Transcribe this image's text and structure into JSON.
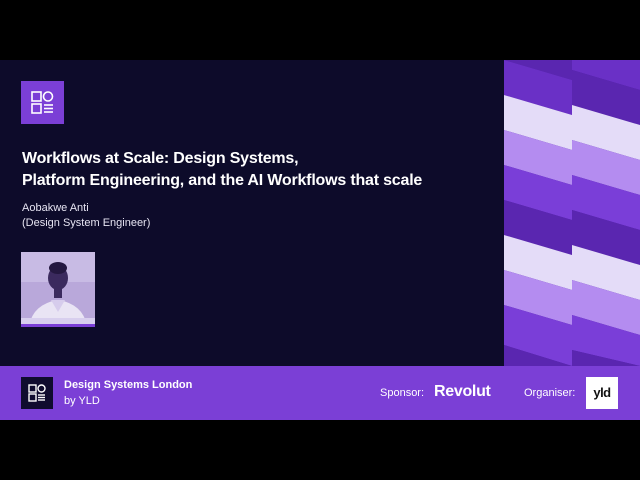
{
  "talk": {
    "title_line1": "Workflows at Scale: Design Systems,",
    "title_line2": "Platform Engineering, and the AI Workflows that scale",
    "speaker_name": "Aobakwe Anti",
    "speaker_role": "(Design System Engineer)"
  },
  "footer": {
    "event_name": "Design Systems London",
    "event_by": "by YLD",
    "sponsor_label": "Sponsor:",
    "sponsor_name": "Revolut",
    "organiser_label": "Organiser:",
    "organiser_name": "yld"
  },
  "icons": {
    "top_logo": "design-systems-logo-icon",
    "footer_logo": "design-systems-logo-icon",
    "organiser_logo": "yld-logo-icon"
  },
  "colors": {
    "background": "#0d0b2a",
    "accent_purple": "#7b3fd6",
    "pattern_light": "#e4dcf8",
    "pattern_mid": "#b48cf0",
    "pattern_dark": "#5a26b0",
    "footer": "#7b3fd6"
  }
}
